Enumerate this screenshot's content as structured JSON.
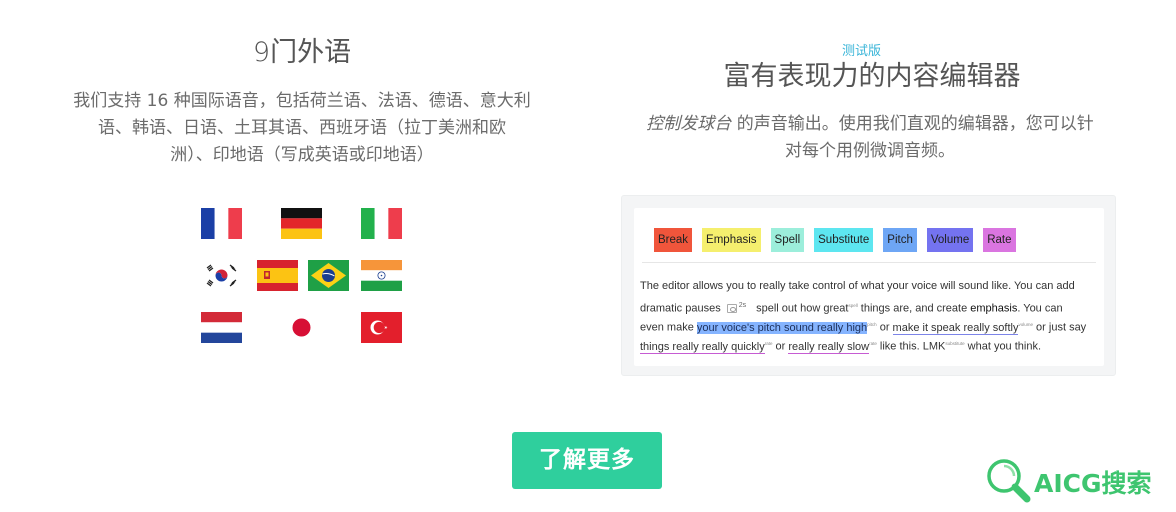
{
  "left": {
    "title": "9门外语",
    "desc_lines": [
      "我们支持 16 种国际语音，包括荷兰语、法语、德语、意大利",
      "语、韩语、日语、土耳其语、西班牙语（拉丁美洲和欧",
      "洲）、印地语（写成英语或印地语）"
    ],
    "flags": [
      "france",
      "germany",
      "italy",
      "south-korea",
      "spain",
      "brazil",
      "india",
      "netherlands",
      "japan",
      "turkey"
    ]
  },
  "right": {
    "beta": "测试版",
    "title": "富有表现力的内容编辑器",
    "desc_em": "控制发球台",
    "desc_line1_rest": " 的声音输出。使用我们直观的编辑器，您可以针",
    "desc_line2": "对每个用例微调音频。"
  },
  "editor": {
    "tags": [
      {
        "label": "Break",
        "color": "#f0553b"
      },
      {
        "label": "Emphasis",
        "color": "#f5ef6e"
      },
      {
        "label": "Spell",
        "color": "#9ceedb"
      },
      {
        "label": "Substitute",
        "color": "#5de6f0"
      },
      {
        "label": "Pitch",
        "color": "#6ea6f5"
      },
      {
        "label": "Volume",
        "color": "#7473f0"
      },
      {
        "label": "Rate",
        "color": "#da75e0"
      }
    ],
    "t1": "The editor allows you to really take control of what your voice will sound like. You can add",
    "t2a": "dramatic pauses",
    "pause": "2s",
    "t2b": "spell out how great",
    "t2sup": "spell",
    "t2c": " things are, and create ",
    "t2em": "emphasis",
    "t2d": ". You can",
    "t3a": "even make ",
    "t3hl": "your voice's pitch sound really high",
    "t3hlsup": "pitch",
    "t3b": " or ",
    "t3ul": "make it speak really softly",
    "t3ulsup": "volume",
    "t3c": " or just say",
    "t4ul1": "things really really quickly",
    "t4sup1": "rate",
    "t4a": " or ",
    "t4ul2": "really really slow",
    "t4sup2": "rate",
    "t4b": " like this. LMK",
    "t4sup3": "substitute",
    "t4c": " what you think."
  },
  "cta": {
    "label": "了解更多"
  },
  "watermark": {
    "text": "AICG搜索",
    "color": "#3ec56f"
  }
}
